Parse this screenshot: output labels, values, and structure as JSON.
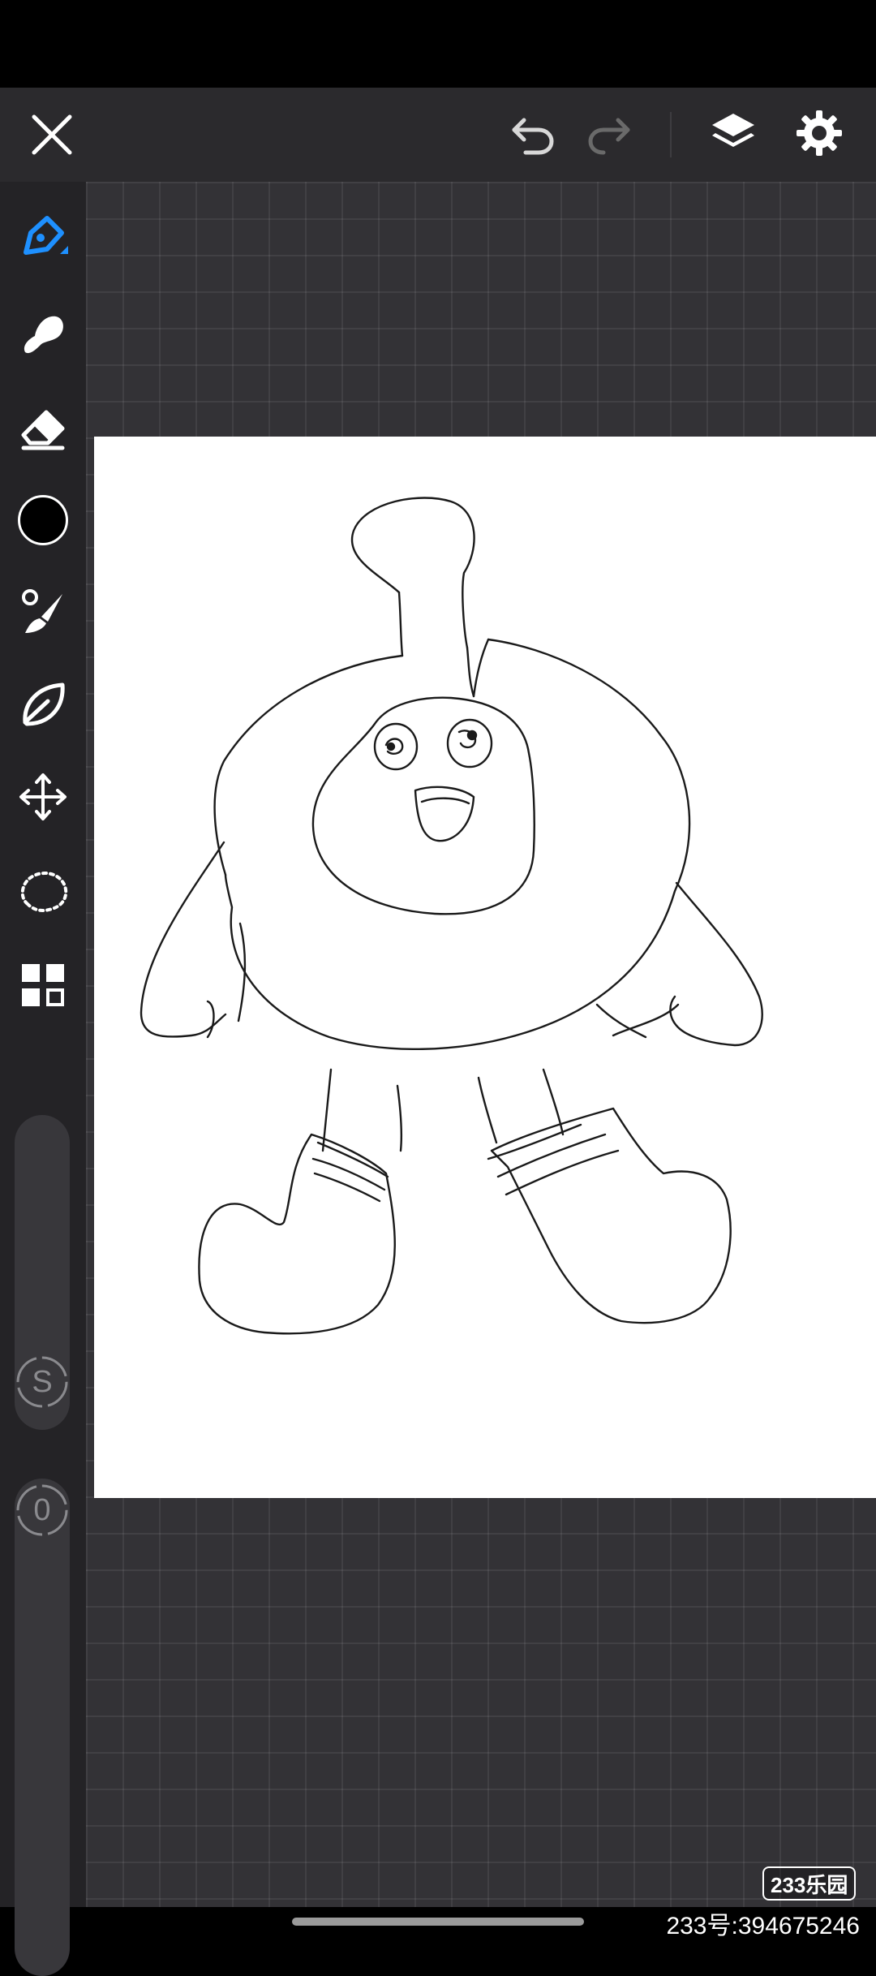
{
  "app": {
    "toolbar": {
      "close_icon": "close-icon",
      "undo_icon": "undo-icon",
      "redo_icon": "redo-icon",
      "layers_icon": "layers-icon",
      "settings_icon": "gear-icon"
    },
    "tools": [
      {
        "name": "pen-tool",
        "icon": "pen-icon",
        "active": true
      },
      {
        "name": "smudge-tool",
        "icon": "smudge-icon"
      },
      {
        "name": "eraser-tool",
        "icon": "eraser-icon"
      },
      {
        "name": "color-swatch",
        "icon": "color-circle",
        "color": "#000000"
      },
      {
        "name": "brush-tool",
        "icon": "brush-icon"
      },
      {
        "name": "lasso-fill-tool",
        "icon": "leaf-icon"
      },
      {
        "name": "transform-tool",
        "icon": "move-arrows-icon"
      },
      {
        "name": "selection-tool",
        "icon": "dotted-selection-icon"
      },
      {
        "name": "gallery-tool",
        "icon": "grid-icon"
      }
    ],
    "size_slider": {
      "label": "S"
    },
    "opacity_slider": {
      "label": "0"
    },
    "colors": {
      "accent": "#1e90ff",
      "toolbar_bg": "#2b2a2d",
      "canvas_bg": "#333236"
    }
  },
  "watermark": {
    "logo_text": "233乐园",
    "id_text": "233号:394675246"
  }
}
